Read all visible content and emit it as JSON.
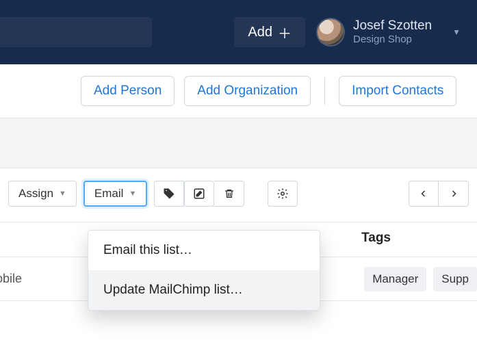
{
  "topbar": {
    "add_label": "Add",
    "user_name": "Josef Szotten",
    "user_sub": "Design Shop"
  },
  "actions": {
    "add_person": "Add Person",
    "add_org": "Add Organization",
    "import": "Import Contacts"
  },
  "toolbar": {
    "assign": "Assign",
    "email": "Email"
  },
  "dropdown": {
    "item1": "Email this list…",
    "item2": "Update MailChimp list…"
  },
  "columns": {
    "tags": "Tags"
  },
  "row": {
    "mobile": "obile",
    "tag1": "Manager",
    "tag2": "Supp"
  }
}
